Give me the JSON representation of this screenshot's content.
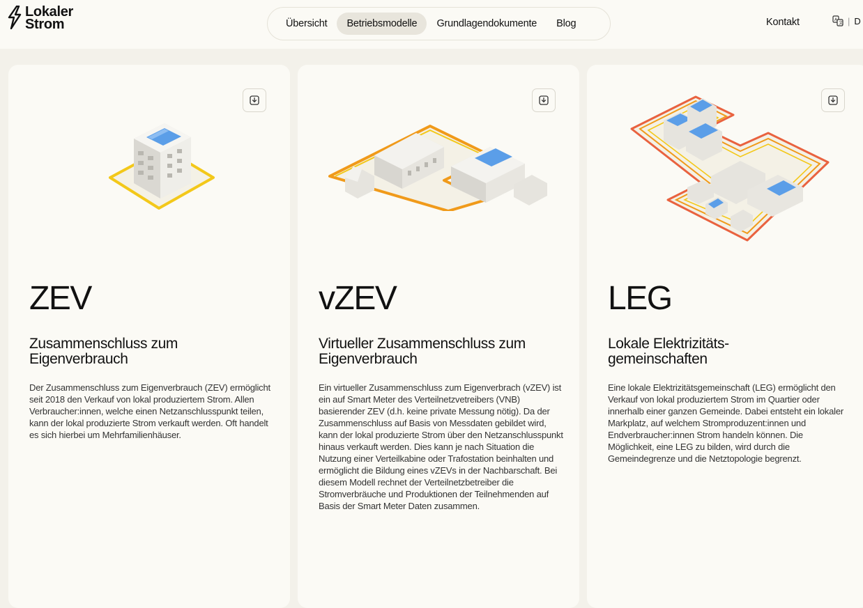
{
  "header": {
    "logo_line1": "Lokaler",
    "logo_line2": "Strom",
    "nav": [
      "Übersicht",
      "Betriebsmodelle",
      "Grundlagendokumente",
      "Blog"
    ],
    "active_nav": "Betriebsmodelle",
    "contact": "Kontakt",
    "lang_code": "D"
  },
  "cards": [
    {
      "title": "ZEV",
      "subtitle": "Zusammenschluss zum Eigenverbrauch",
      "body": "Der Zusammenschluss zum Eigenverbrauch (ZEV) ermöglicht seit 2018 den Verkauf von lokal produziertem Strom. Allen Verbraucher:innen, welche einen Netzanschlusspunkt teilen, kann der lokal produzierte Strom verkauft werden. Oft handelt es sich hierbei um Mehrfamilienhäuser."
    },
    {
      "title": "vZEV",
      "subtitle": "Virtueller Zusammenschluss zum Eigenverbrauch",
      "body": "Ein virtueller Zusammenschluss zum Eigenverbrach (vZEV) ist ein auf Smart Meter des Verteilnetzvetreibers (VNB) basierender ZEV (d.h. keine private Messung nötig). Da der Zusammenschluss auf Basis von Messdaten gebildet wird, kann der lokal produzierte Strom über den Netzanschlusspunkt hinaus verkauft werden. Dies kann je nach Situation die Nutzung einer Verteilkabine oder Trafostation beinhalten und ermöglicht die Bildung eines vZEVs in der Nachbarschaft. Bei diesem Modell rechnet der Verteilnetzbetreiber die Stromverbräuche und Produktionen der Teilnehmenden auf Basis der Smart Meter Daten zusammen."
    },
    {
      "title": "LEG",
      "subtitle": "Lokale Elektrizitäts-gemeinschaften",
      "body": "Eine lokale Elektrizitätsgemeinschaft (LEG) ermöglicht den Verkauf von lokal produziertem Strom im Quartier oder innerhalb einer ganzen Gemeinde. Dabei entsteht ein lokaler Markplatz, auf welchem Stromproduzent:innen und Endverbraucher:innen Strom handeln können. Die Möglichkeit, eine LEG zu bilden, wird durch die Gemeindegrenze und die Netztopologie begrenzt."
    }
  ],
  "icons": {
    "logo": "lightning-bolt-icon",
    "download": "download-icon",
    "language": "translate-icon"
  },
  "colors": {
    "yellow": "#f3c81a",
    "orange": "#f09a1a",
    "red": "#e9623f",
    "solar": "#5b9ee8"
  }
}
